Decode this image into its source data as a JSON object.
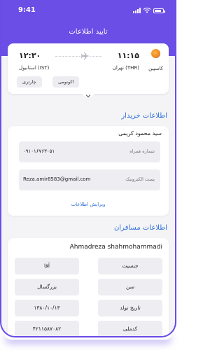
{
  "status_bar": {
    "time": "9:41"
  },
  "header": {
    "title": "تایید اطلاعات"
  },
  "flight": {
    "airline": "کاسپین",
    "departure_time": "۱۱:۱۵",
    "departure_city": "تهران (THR)",
    "arrival_time": "۱۲:۳۰",
    "arrival_city": "استانبول (IST)",
    "class": "اکونومی",
    "flight_type": "چارتری"
  },
  "buyer": {
    "section_title": "اطلاعات خریدار",
    "name": "سید محمود کریمی",
    "phone_label": "شماره همراه",
    "phone_value": "۰۹۱۰۱۶۷۶۳۰۵۱",
    "email_label": "پست الکترونیک",
    "email_value": "Reza.amir8583@gmail.com",
    "edit_label": "ویرایش اطلاعات"
  },
  "passengers": {
    "section_title": "اطلاعات مسافران",
    "name": "Ahmadreza shahmohammadi",
    "rows": [
      {
        "label": "جنسیت",
        "value": "آقا"
      },
      {
        "label": "سن",
        "value": "بزرگسال"
      },
      {
        "label": "تاریخ تولد",
        "value": "۱۳۸۰/۱۰/۱۳"
      },
      {
        "label": "کدملی",
        "value": "۴۲۱۱۵۸۷۰۸۲"
      }
    ]
  },
  "colors": {
    "primary": "#6b4ee6",
    "link": "#2e6fd6",
    "field_bg": "#eeeef2"
  },
  "icons": {
    "plane": "airplane-icon",
    "expand": "chevron-down-icon"
  }
}
